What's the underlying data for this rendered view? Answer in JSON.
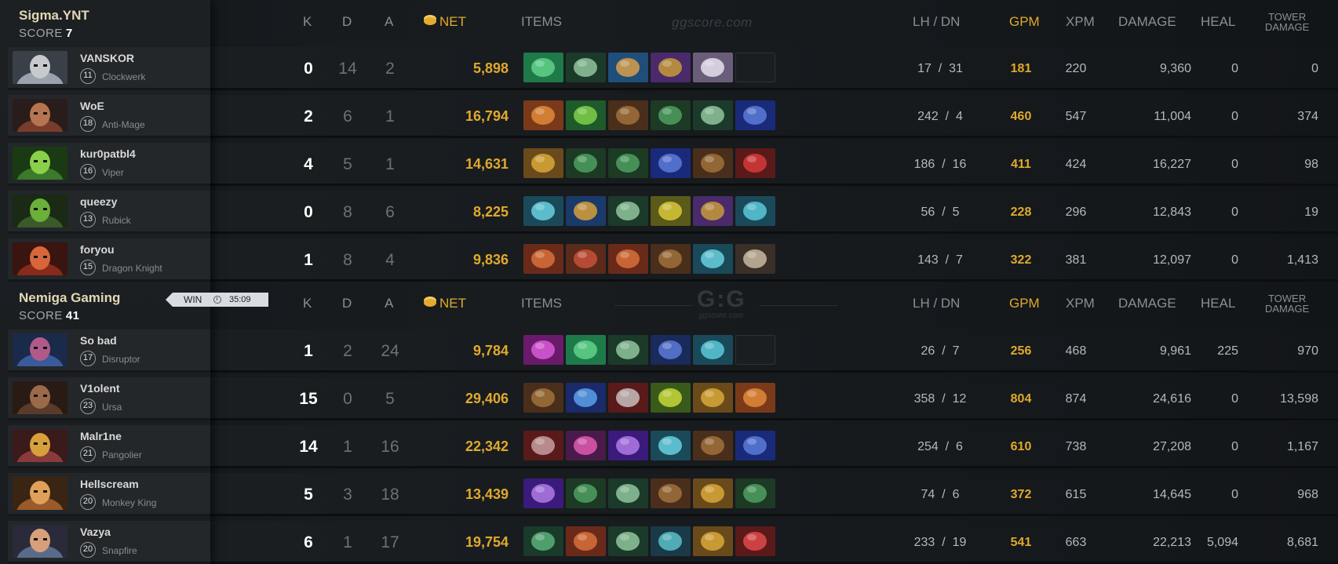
{
  "columns": {
    "k": "K",
    "d": "D",
    "a": "A",
    "net": "NET",
    "items": "ITEMS",
    "lh_dn": "LH  /  DN",
    "gpm": "GPM",
    "xpm": "XPM",
    "damage": "DAMAGE",
    "heal": "HEAL",
    "tower_line1": "TOWER",
    "tower_line2": "DAMAGE"
  },
  "watermark": "ggscore.com",
  "logo": {
    "mark": "G:G",
    "sub": "ggscore.com"
  },
  "win_badge": {
    "label": "WIN",
    "time": "35:09"
  },
  "teams": [
    {
      "name": "Sigma.YNT",
      "score_label": "SCORE",
      "score": "7",
      "players": [
        {
          "name": "VANSKOR",
          "level": "11",
          "hero": "Clockwerk",
          "k": "0",
          "d": "14",
          "a": "2",
          "net": "5,898",
          "lh": "17",
          "dn": "31",
          "gpm": "181",
          "xpm": "220",
          "damage": "9,360",
          "heal": "0",
          "tower": "0",
          "portrait": [
            "#9aa3ad",
            "#3a4048",
            "#c7c9cc"
          ],
          "items": [
            [
              "boots-green",
              "#1f7a4a",
              "#5fd28a"
            ],
            [
              "wand-green",
              "#1c3a2a",
              "#8fc79c"
            ],
            [
              "lens-blue",
              "#1f4e7a",
              "#d9a04a"
            ],
            [
              "purple-orb",
              "#4a2a6a",
              "#c69a3a"
            ],
            [
              "white-helm",
              "#6a5d7a",
              "#e6e0ee"
            ],
            [
              "empty"
            ]
          ]
        },
        {
          "name": "WoE",
          "level": "18",
          "hero": "Anti-Mage",
          "k": "2",
          "d": "6",
          "a": "1",
          "net": "16,794",
          "lh": "242",
          "dn": "4",
          "gpm": "460",
          "xpm": "547",
          "damage": "11,004",
          "heal": "0",
          "tower": "374",
          "portrait": [
            "#7a3c2a",
            "#2a1c1a",
            "#b67452"
          ],
          "items": [
            [
              "battlefury",
              "#7a3a1a",
              "#e08a3a"
            ],
            [
              "green-blade",
              "#1f5a2a",
              "#7fd04a"
            ],
            [
              "brown-boots",
              "#4a2e1c",
              "#a0703a"
            ],
            [
              "green-mask",
              "#1c3a24",
              "#4ea060"
            ],
            [
              "wand-green",
              "#1c3a2a",
              "#8fc79c"
            ],
            [
              "blue-staff",
              "#1a2a7a",
              "#5a7ad8"
            ]
          ]
        },
        {
          "name": "kur0patbl4",
          "level": "16",
          "hero": "Viper",
          "k": "4",
          "d": "5",
          "a": "1",
          "net": "14,631",
          "lh": "186",
          "dn": "16",
          "gpm": "411",
          "xpm": "424",
          "damage": "16,227",
          "heal": "0",
          "tower": "98",
          "portrait": [
            "#3a7a2a",
            "#1a3a14",
            "#8ad04a"
          ],
          "items": [
            [
              "gold-helm",
              "#6a4a1a",
              "#d8a83a"
            ],
            [
              "green-mask",
              "#1c3a24",
              "#4ea060"
            ],
            [
              "green-mask2",
              "#1c3a24",
              "#4ea060"
            ],
            [
              "blue-staff",
              "#1a2a7a",
              "#5a7ad8"
            ],
            [
              "brown-boots",
              "#4a2e1c",
              "#a0703a"
            ],
            [
              "red-claw",
              "#5a1a1a",
              "#d83a3a"
            ]
          ]
        },
        {
          "name": "queezy",
          "level": "13",
          "hero": "Rubick",
          "k": "0",
          "d": "8",
          "a": "6",
          "net": "8,225",
          "lh": "56",
          "dn": "5",
          "gpm": "228",
          "xpm": "296",
          "damage": "12,843",
          "heal": "0",
          "tower": "19",
          "portrait": [
            "#3a5a2a",
            "#1a2a14",
            "#6ab03a"
          ],
          "items": [
            [
              "cyan-wind",
              "#1a4a5a",
              "#6ad0e0"
            ],
            [
              "blue-bracer",
              "#1a3a6a",
              "#d8a03a"
            ],
            [
              "wand-green",
              "#1c3a2a",
              "#8fc79c"
            ],
            [
              "gold-mask",
              "#5a5a1a",
              "#d8c83a"
            ],
            [
              "purple-orb",
              "#4a2a6a",
              "#c69a3a"
            ],
            [
              "cyan-ring",
              "#1a4a5a",
              "#5ac8d8"
            ]
          ]
        },
        {
          "name": "foryou",
          "level": "15",
          "hero": "Dragon Knight",
          "k": "1",
          "d": "8",
          "a": "4",
          "net": "9,836",
          "lh": "143",
          "dn": "7",
          "gpm": "322",
          "xpm": "381",
          "damage": "12,097",
          "heal": "0",
          "tower": "1,413",
          "portrait": [
            "#8a2a1a",
            "#3a140e",
            "#d8663a"
          ],
          "items": [
            [
              "red-gauntlet",
              "#6a2a1a",
              "#d8703a"
            ],
            [
              "red-axe",
              "#5a2a1a",
              "#c8503a"
            ],
            [
              "red-gauntlet2",
              "#6a2a1a",
              "#d8703a"
            ],
            [
              "brown-boots",
              "#4a2e1c",
              "#a0703a"
            ],
            [
              "cyan-wind",
              "#1a4a5a",
              "#6ad0e0"
            ],
            [
              "grey-axe",
              "#3a3028",
              "#c8b8a0"
            ]
          ]
        }
      ]
    },
    {
      "name": "Nemiga Gaming",
      "score_label": "SCORE",
      "score": "41",
      "players": [
        {
          "name": "So bad",
          "level": "17",
          "hero": "Disruptor",
          "k": "1",
          "d": "2",
          "a": "24",
          "net": "9,784",
          "lh": "26",
          "dn": "7",
          "gpm": "256",
          "xpm": "468",
          "damage": "9,961",
          "heal": "225",
          "tower": "970",
          "portrait": [
            "#3a5a9a",
            "#1a2a4a",
            "#b05a8a"
          ],
          "items": [
            [
              "magenta-orb",
              "#6a1a6a",
              "#d85ad8"
            ],
            [
              "boots-green",
              "#1f7a4a",
              "#5fd28a"
            ],
            [
              "wand-green",
              "#1c3a2a",
              "#8fc79c"
            ],
            [
              "blue-cloak",
              "#1a2a5a",
              "#5a7ad8"
            ],
            [
              "cyan-ring",
              "#1a4a5a",
              "#5ac8d8"
            ],
            [
              "empty"
            ]
          ]
        },
        {
          "name": "V1olent",
          "level": "23",
          "hero": "Ursa",
          "k": "15",
          "d": "0",
          "a": "5",
          "net": "29,406",
          "lh": "358",
          "dn": "12",
          "gpm": "804",
          "xpm": "874",
          "damage": "24,616",
          "heal": "0",
          "tower": "13,598",
          "portrait": [
            "#5a3a2a",
            "#2a1a14",
            "#9a6a4a"
          ],
          "items": [
            [
              "brown-boots",
              "#4a2e1c",
              "#a0703a"
            ],
            [
              "blue-vortex",
              "#1a2a6a",
              "#5aa0e8"
            ],
            [
              "red-blades",
              "#5a1a1a",
              "#c8c0c0"
            ],
            [
              "green-dagger",
              "#3a5a1a",
              "#c8d83a"
            ],
            [
              "gold-helm",
              "#6a4a1a",
              "#d8a83a"
            ],
            [
              "battlefury",
              "#7a3a1a",
              "#e08a3a"
            ]
          ]
        },
        {
          "name": "Malr1ne",
          "level": "21",
          "hero": "Pangolier",
          "k": "14",
          "d": "1",
          "a": "16",
          "net": "22,342",
          "lh": "254",
          "dn": "6",
          "gpm": "610",
          "xpm": "738",
          "damage": "27,208",
          "heal": "0",
          "tower": "1,167",
          "portrait": [
            "#8a3a3a",
            "#3a1a1a",
            "#d8a03a"
          ],
          "items": [
            [
              "red-hammer",
              "#5a1a1a",
              "#c8a0a0"
            ],
            [
              "purple-ball",
              "#4a1a4a",
              "#e05ab0"
            ],
            [
              "violet-blade",
              "#3a1a7a",
              "#b07ae8"
            ],
            [
              "cyan-wind",
              "#1a4a5a",
              "#6ad0e0"
            ],
            [
              "brown-boots",
              "#4a2e1c",
              "#a0703a"
            ],
            [
              "blue-staff",
              "#1a2a7a",
              "#5a7ad8"
            ]
          ]
        },
        {
          "name": "Hellscream",
          "level": "20",
          "hero": "Monkey King",
          "k": "5",
          "d": "3",
          "a": "18",
          "net": "13,439",
          "lh": "74",
          "dn": "6",
          "gpm": "372",
          "xpm": "615",
          "damage": "14,645",
          "heal": "0",
          "tower": "968",
          "portrait": [
            "#9a5a2a",
            "#3a2414",
            "#e0a05a"
          ],
          "items": [
            [
              "violet-blade",
              "#3a1a7a",
              "#b07ae8"
            ],
            [
              "green-mask",
              "#1c3a24",
              "#4ea060"
            ],
            [
              "wand-green",
              "#1c3a2a",
              "#8fc79c"
            ],
            [
              "brown-boots",
              "#4a2e1c",
              "#a0703a"
            ],
            [
              "gold-helm",
              "#6a4a1a",
              "#d8a83a"
            ],
            [
              "green-mask2",
              "#1c3a24",
              "#4ea060"
            ]
          ]
        },
        {
          "name": "Vazya",
          "level": "20",
          "hero": "Snapfire",
          "k": "6",
          "d": "1",
          "a": "17",
          "net": "19,754",
          "lh": "233",
          "dn": "19",
          "gpm": "541",
          "xpm": "663",
          "damage": "22,213",
          "heal": "5,094",
          "tower": "8,681",
          "portrait": [
            "#5a6a8a",
            "#2a2a3a",
            "#d8a07a"
          ],
          "items": [
            [
              "green-wand2",
              "#1a3a2a",
              "#5ab07a"
            ],
            [
              "red-gauntlet",
              "#6a2a1a",
              "#d8703a"
            ],
            [
              "wand-green",
              "#1c3a2a",
              "#8fc79c"
            ],
            [
              "cyan-boots",
              "#1a3a4a",
              "#5ac0c8"
            ],
            [
              "gold-helm",
              "#6a4a1a",
              "#d8a83a"
            ],
            [
              "red-sword",
              "#5a1a1a",
              "#e04a4a"
            ]
          ]
        }
      ]
    }
  ]
}
